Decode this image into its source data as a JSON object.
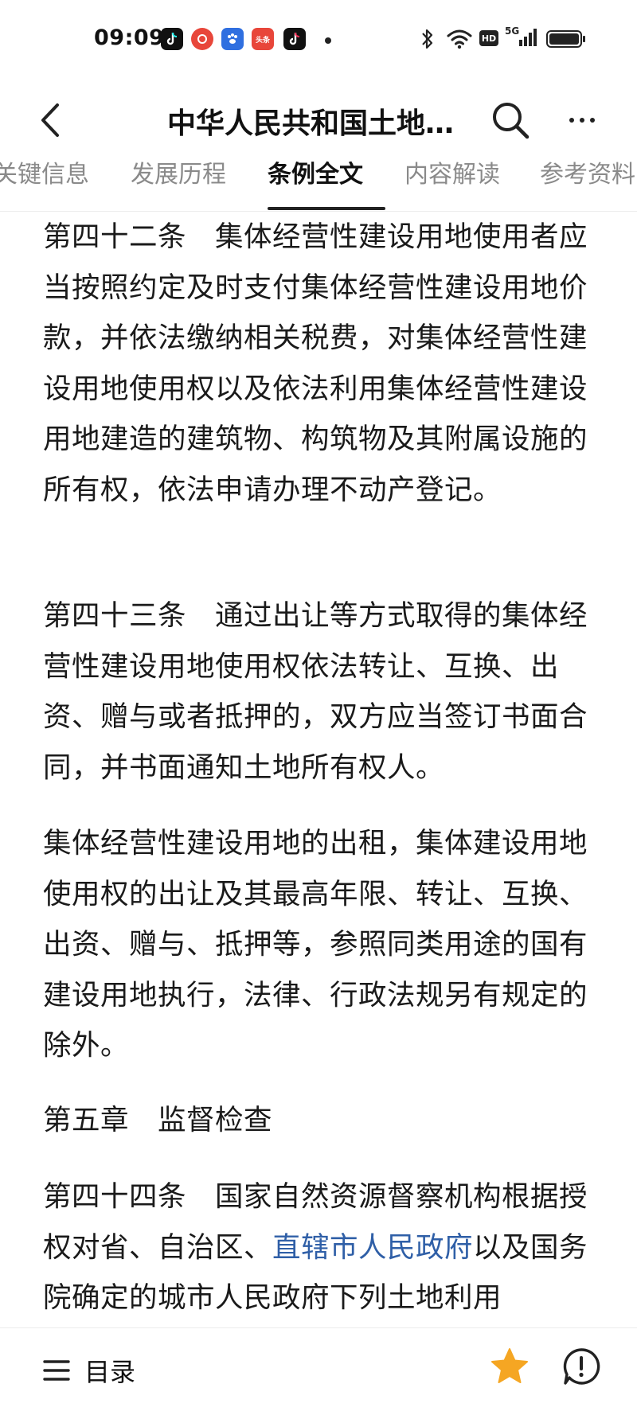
{
  "status_bar": {
    "time": "09:09",
    "apps": [
      {
        "icon": "tiktok-app-icon",
        "color": "#111111",
        "label": ""
      },
      {
        "icon": "red-app-icon",
        "color": "#e8463a",
        "label": ""
      },
      {
        "icon": "baidu-app-icon",
        "color": "#2f6fe0",
        "label": ""
      },
      {
        "icon": "toutiao-app-icon",
        "color": "#e8463a",
        "label": "头条"
      },
      {
        "icon": "tiktok-app-icon",
        "color": "#111111",
        "label": ""
      }
    ],
    "network": "5G",
    "hd_label": "HD"
  },
  "header": {
    "title": "中华人民共和国土地…"
  },
  "tabs": [
    {
      "label": "关键信息"
    },
    {
      "label": "发展历程"
    },
    {
      "label": "条例全文"
    },
    {
      "label": "内容解读"
    },
    {
      "label": "参考资料"
    }
  ],
  "active_tab": "条例全文",
  "content": {
    "p1": "第四十二条　集体经营性建设用地使用者应当按照约定及时支付集体经营性建设用地价款，并依法缴纳相关税费，对集体经营性建设用地使用权以及依法利用集体经营性建设用地建造的建筑物、构筑物及其附属设施的所有权，依法申请办理不动产登记。",
    "p2": "第四十三条　通过出让等方式取得的集体经营性建设用地使用权依法转让、互换、出资、赠与或者抵押的，双方应当签订书面合同，并书面通知土地所有权人。",
    "p3": "集体经营性建设用地的出租，集体建设用地使用权的出让及其最高年限、转让、互换、出资、赠与、抵押等，参照同类用途的国有建设用地执行，法律、行政法规另有规定的除外。",
    "p4": "第五章　监督检查",
    "p5_prefix": "第四十四条　国家自然资源督察机构根据授权对省、自治区、",
    "p5_link": "直辖市人民政府",
    "p5_suffix": "以及国务院确定的城市人民政府下列土地利用"
  },
  "bottom_bar": {
    "toc_label": "目录",
    "star_color": "#f5a623"
  },
  "colors": {
    "link": "#2f5fa7",
    "text": "#1a1a1a",
    "tab_inactive": "#8a8a8a"
  }
}
